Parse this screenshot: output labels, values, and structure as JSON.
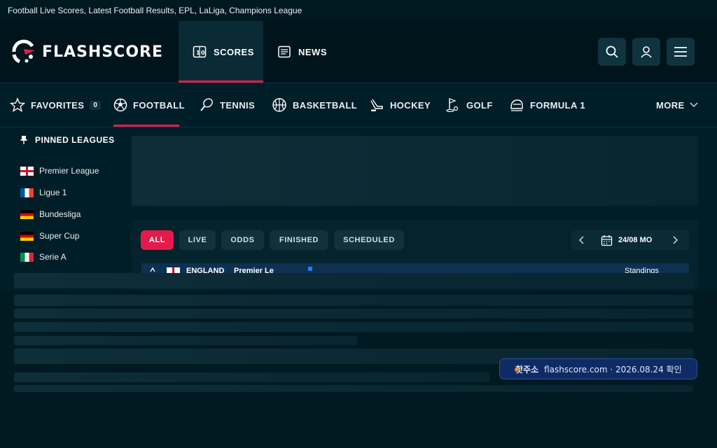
{
  "window": {
    "title": "Football Live Scores, Latest Football Results, EPL, LaLiga, Champions League"
  },
  "header": {
    "logo_text": "FLASHSCORE",
    "nav": [
      {
        "label": "SCORES",
        "icon": "scoreboard-icon",
        "active": true
      },
      {
        "label": "NEWS",
        "icon": "newspaper-icon",
        "active": false
      }
    ],
    "actions": [
      "search-icon",
      "user-icon",
      "menu-icon"
    ]
  },
  "sports": {
    "favorites": {
      "label": "FAVORITES",
      "count": "0"
    },
    "items": [
      {
        "label": "FOOTBALL",
        "icon": "football-icon",
        "active": true
      },
      {
        "label": "TENNIS",
        "icon": "tennis-icon"
      },
      {
        "label": "BASKETBALL",
        "icon": "basketball-icon"
      },
      {
        "label": "HOCKEY",
        "icon": "hockey-icon"
      },
      {
        "label": "GOLF",
        "icon": "golf-icon"
      },
      {
        "label": "FORMULA 1",
        "icon": "formula1-icon"
      }
    ],
    "more_label": "MORE"
  },
  "sidebar": {
    "title": "PINNED LEAGUES",
    "leagues": [
      {
        "name": "Premier League",
        "flag": "england"
      },
      {
        "name": "Ligue 1",
        "flag": "france"
      },
      {
        "name": "Bundesliga",
        "flag": "germany"
      },
      {
        "name": "Super Cup",
        "flag": "germany"
      },
      {
        "name": "Serie A",
        "flag": "italy"
      }
    ]
  },
  "filters": {
    "items": [
      "ALL",
      "LIVE",
      "ODDS",
      "FINISHED",
      "SCHEDULED"
    ],
    "active": "ALL",
    "date": "24/08 MO"
  },
  "league_row": {
    "country": "ENGLAND",
    "league": "Premier Le",
    "standings": "Standings"
  },
  "toast": {
    "name": "핫주소",
    "text": "flashscore.com · 2026.08.24 확인"
  },
  "colors": {
    "accent": "#e41b4a",
    "background": "#001e28",
    "header": "#00141c",
    "toast": "#0f2b63"
  }
}
